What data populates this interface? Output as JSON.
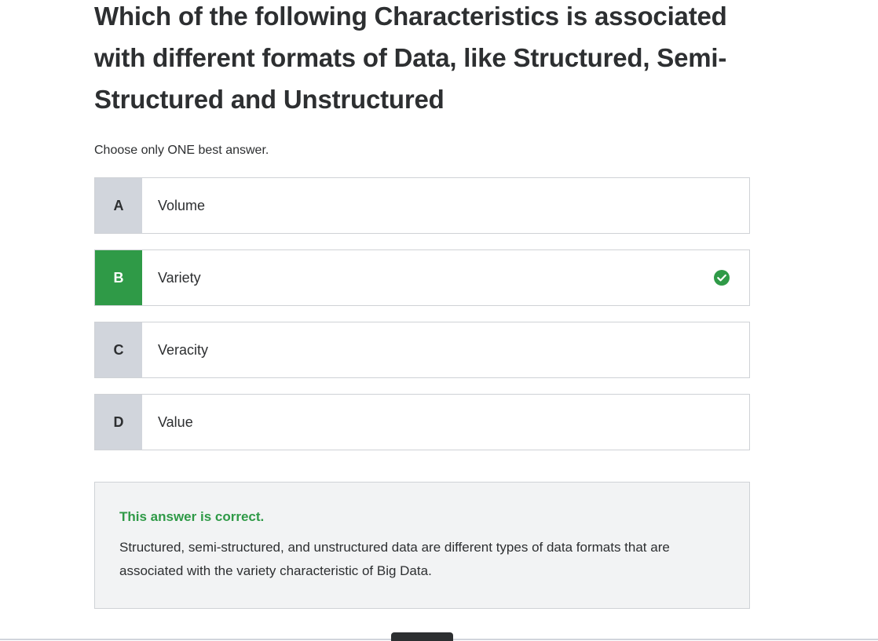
{
  "question": {
    "title": "Which of the following Characteristics is associated with different formats of Data, like Structured, Semi-Structured and Unstructured",
    "instruction": "Choose only ONE best answer."
  },
  "options": [
    {
      "letter": "A",
      "text": "Volume",
      "state": "default"
    },
    {
      "letter": "B",
      "text": "Variety",
      "state": "correct"
    },
    {
      "letter": "C",
      "text": "Veracity",
      "state": "default"
    },
    {
      "letter": "D",
      "text": "Value",
      "state": "default"
    }
  ],
  "feedback": {
    "title": "This answer is correct.",
    "body": "Structured, semi-structured, and unstructured data are different types of data formats that are associated with the variety characteristic of Big Data."
  },
  "icons": {
    "correct": "check-circle-icon"
  },
  "colors": {
    "correct": "#2f9a47",
    "letter_default": "#d1d5dc",
    "text": "#2d2f31",
    "feedback_bg": "#f2f3f4"
  }
}
